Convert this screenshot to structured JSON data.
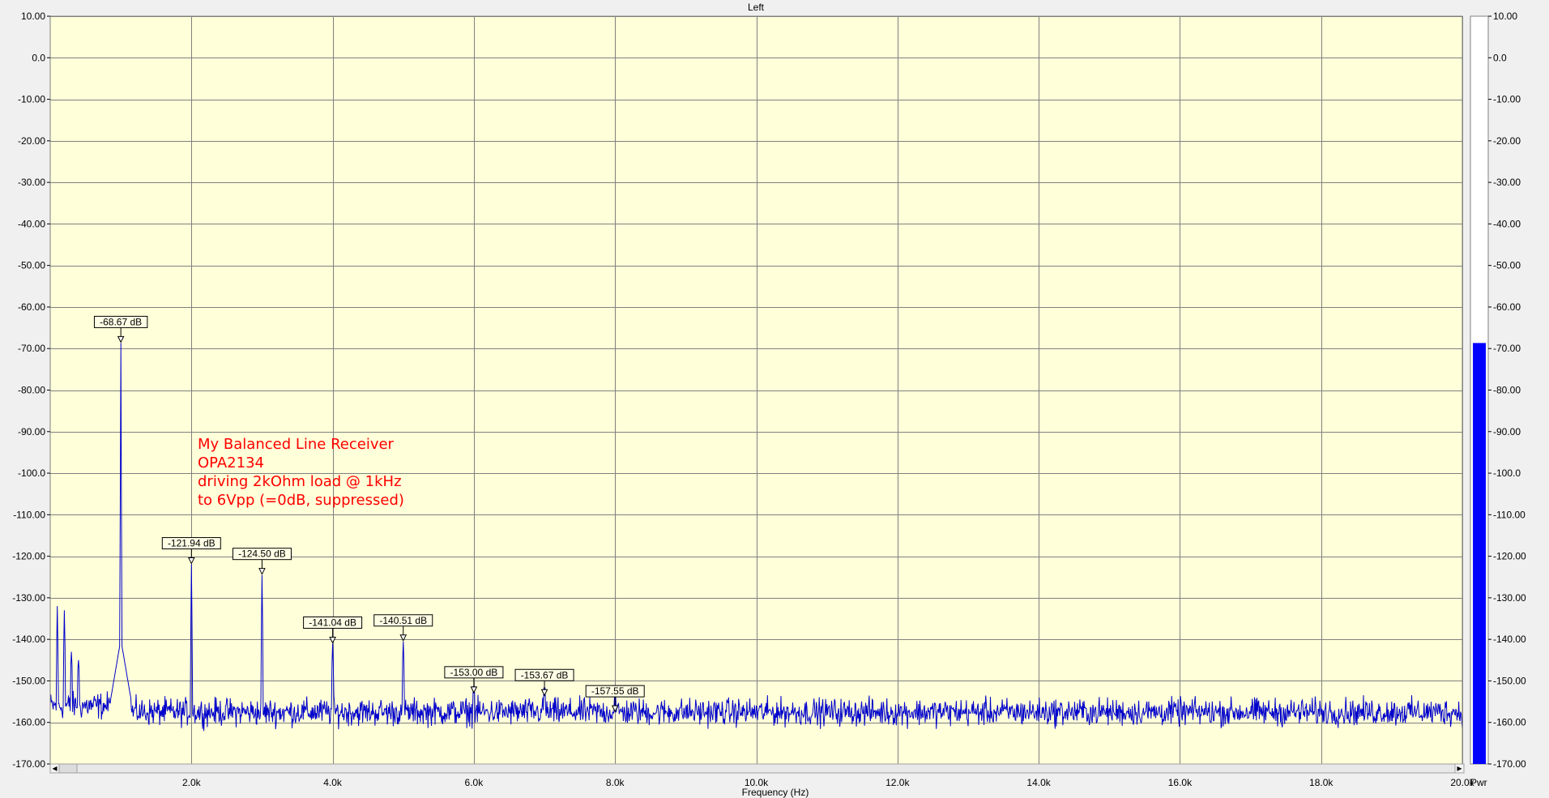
{
  "window": {
    "title": "Left"
  },
  "chart_data": {
    "type": "line",
    "title": "Left",
    "xlabel": "Frequency (Hz)",
    "ylabel": "",
    "xlim": [
      0,
      20000
    ],
    "ylim": [
      -170,
      10
    ],
    "grid": true,
    "x_ticks": [
      2000,
      4000,
      6000,
      8000,
      10000,
      12000,
      14000,
      16000,
      18000,
      20000
    ],
    "x_tick_labels": [
      "2.0k",
      "4.0k",
      "6.0k",
      "8.0k",
      "10.0k",
      "12.0k",
      "14.0k",
      "16.0k",
      "18.0k",
      "20.0k"
    ],
    "y_ticks": [
      10,
      0,
      -10,
      -20,
      -30,
      -40,
      -50,
      -60,
      -70,
      -80,
      -90,
      -100,
      -110,
      -120,
      -130,
      -140,
      -150,
      -160,
      -170
    ],
    "y_tick_labels": [
      "10.00",
      "0.0",
      "-10.00",
      "-20.00",
      "-30.00",
      "-40.00",
      "-50.00",
      "-60.00",
      "-70.00",
      "-80.00",
      "-90.00",
      "-100.0",
      "-110.00",
      "-120.00",
      "-130.00",
      "-140.00",
      "-150.00",
      "-160.00",
      "-170.00"
    ],
    "series": [
      {
        "color": "#0000cc",
        "noise_floor_db": -157.5,
        "peaks": [
          {
            "x": 100,
            "y": -132
          },
          {
            "x": 200,
            "y": -133
          },
          {
            "x": 300,
            "y": -143
          },
          {
            "x": 400,
            "y": -145
          },
          {
            "x": 1000,
            "y": -68.67
          },
          {
            "x": 2000,
            "y": -121.94
          },
          {
            "x": 3000,
            "y": -124.5
          },
          {
            "x": 4000,
            "y": -141.04
          },
          {
            "x": 5000,
            "y": -140.51
          },
          {
            "x": 6000,
            "y": -153.0
          },
          {
            "x": 7000,
            "y": -153.67
          },
          {
            "x": 8000,
            "y": -157.55
          }
        ]
      }
    ],
    "annotations": [
      {
        "x": 1000,
        "y": -68.67,
        "text": "-68.67 dB"
      },
      {
        "x": 2000,
        "y": -121.94,
        "text": "-121.94 dB"
      },
      {
        "x": 3000,
        "y": -124.5,
        "text": "-124.50 dB"
      },
      {
        "x": 4000,
        "y": -141.04,
        "text": "-141.04 dB"
      },
      {
        "x": 5000,
        "y": -140.51,
        "text": "-140.51 dB"
      },
      {
        "x": 6000,
        "y": -153.0,
        "text": "-153.00 dB"
      },
      {
        "x": 7000,
        "y": -153.67,
        "text": "-153.67 dB"
      },
      {
        "x": 8000,
        "y": -157.55,
        "text": "-157.55 dB"
      }
    ],
    "note_lines": [
      "My Balanced Line Receiver",
      "OPA2134",
      "driving 2kOhm load @ 1kHz",
      "to 6Vpp (=0dB, suppressed)"
    ]
  },
  "power_meter": {
    "label": "Pwr",
    "value_db": -68.67,
    "ylim": [
      -170,
      10
    ],
    "y_tick_labels": [
      "10.00",
      "0.0",
      "-10.00",
      "-20.00",
      "-30.00",
      "-40.00",
      "-50.00",
      "-60.00",
      "-70.00",
      "-80.00",
      "-90.00",
      "-100.0",
      "-110.00",
      "-120.00",
      "-130.00",
      "-140.00",
      "-150.00",
      "-160.00",
      "-170.00"
    ],
    "bar_color": "#0000ff"
  },
  "scrollbar": {
    "left_arrow": "◂",
    "right_arrow": "▸"
  },
  "colors": {
    "plot_bg": "#ffffd9",
    "grid": "#808080",
    "trace": "#0000cc",
    "note": "#ff0000",
    "window_bg": "#f0f0f0"
  }
}
